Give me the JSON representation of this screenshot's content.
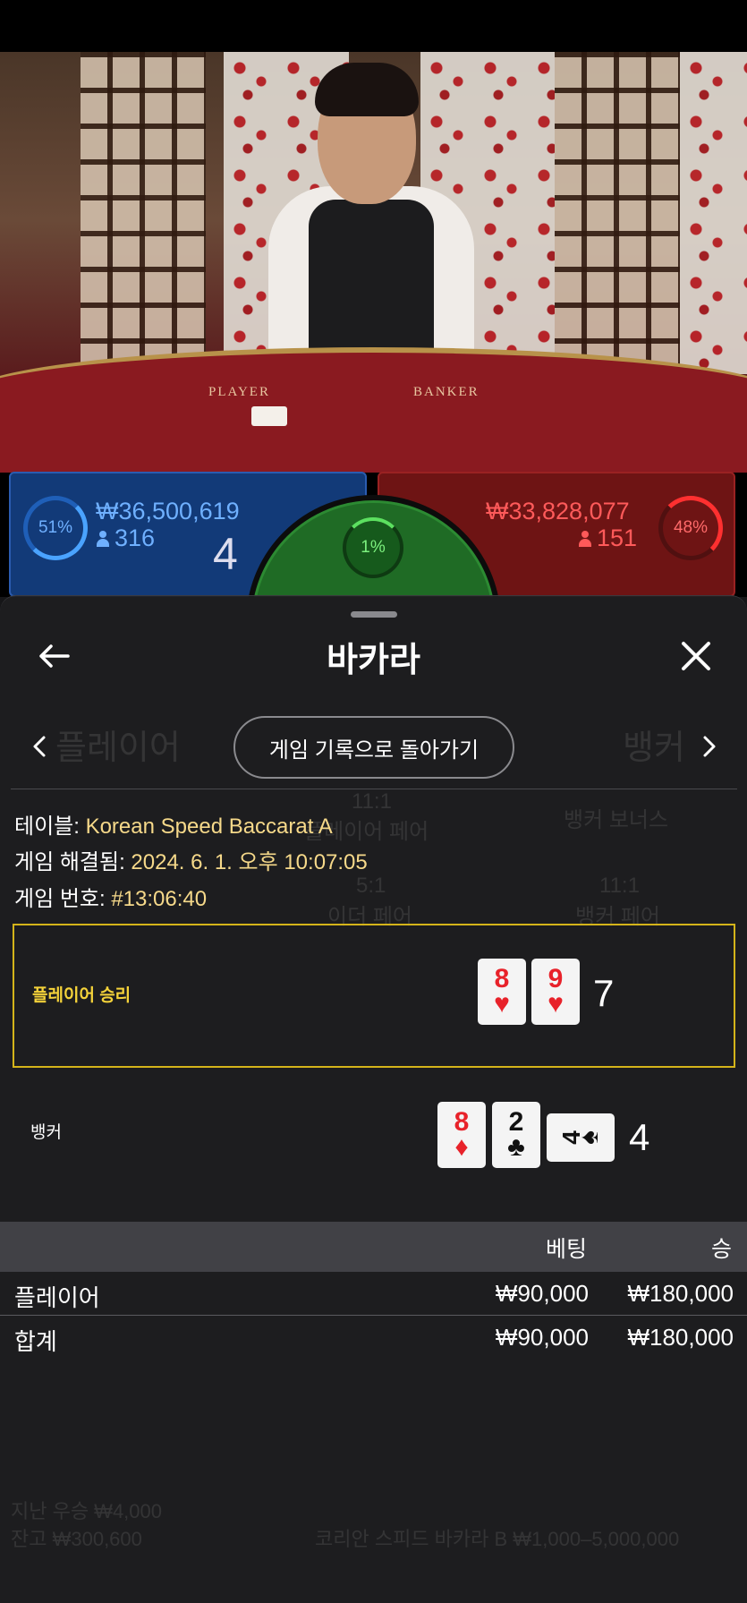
{
  "video": {
    "felt_player": "PLAYER",
    "felt_banker": "BANKER"
  },
  "betting": {
    "player": {
      "percent": "51%",
      "amount": "₩36,500,619",
      "count": "316",
      "score": "4"
    },
    "tie": {
      "percent": "1%"
    },
    "banker": {
      "percent": "48%",
      "amount": "₩33,828,077",
      "count": "151"
    }
  },
  "background": {
    "player_tab": "플레이어",
    "banker_tab": "뱅커",
    "payout_11": "11:1",
    "payout_pair": "플레이어 페어",
    "banker_bonus": "뱅커 보너스",
    "payout_5": "5:1",
    "either_pair": "이더 페어",
    "payout_11b": "11:1",
    "banker_pair": "뱅커 페어",
    "last_win": "지난 우승 ₩4,000",
    "balance": "잔고 ₩300,600",
    "table_limits": "코리안 스피드 바카라 B ₩1,000–5,000,000"
  },
  "sheet": {
    "title": "바카라",
    "history_button": "게임 기록으로 돌아가기",
    "table_label": "테이블: ",
    "table_value": "Korean Speed Baccarat A",
    "resolved_label": "게임 해결됨: ",
    "resolved_value": "2024. 6. 1. 오후 10:07:05",
    "round_label": "게임 번호: ",
    "round_value": "#13:06:40"
  },
  "hands": {
    "player": {
      "label": "플레이어 승리",
      "cards": [
        {
          "rank": "8",
          "suit": "♥"
        },
        {
          "rank": "9",
          "suit": "♥"
        }
      ],
      "total": "7"
    },
    "banker": {
      "label": "뱅커",
      "cards": [
        {
          "rank": "8",
          "suit": "♦"
        },
        {
          "rank": "2",
          "suit": "♣"
        },
        {
          "rank": "4",
          "suit": "♠"
        }
      ],
      "total": "4"
    }
  },
  "bets_table": {
    "headers": [
      "베팅",
      "승"
    ],
    "rows": [
      {
        "label": "플레이어",
        "bet": "₩90,000",
        "win": "₩180,000"
      },
      {
        "label": "합계",
        "bet": "₩90,000",
        "win": "₩180,000"
      }
    ]
  },
  "colors": {
    "player_blue": "#123a78",
    "banker_red": "#6e1414",
    "tie_green": "#1f6b25",
    "winner_border": "#d4b41a",
    "info_value": "#f6d98a"
  },
  "icons": [
    "arrow-left-icon",
    "close-icon",
    "chevron-left-icon",
    "chevron-right-icon",
    "person-icon"
  ]
}
